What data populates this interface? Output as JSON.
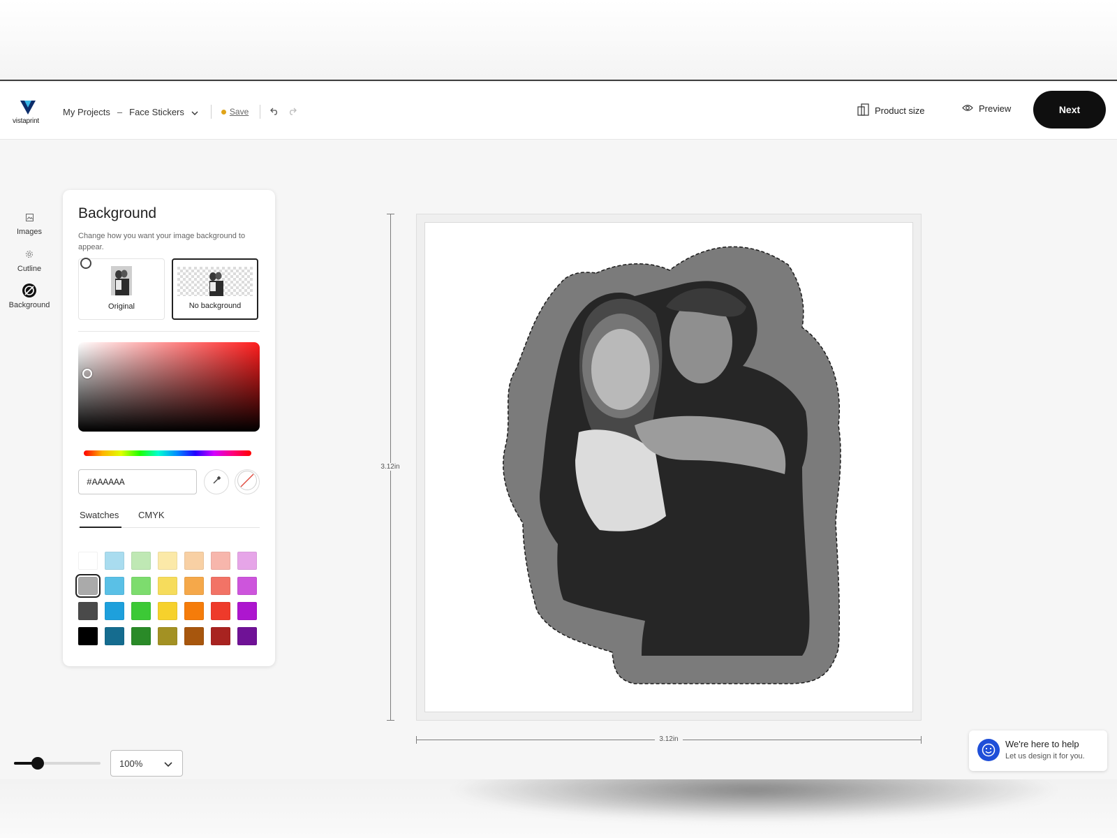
{
  "header": {
    "logo_text": "vistaprint",
    "breadcrumb_root": "My Projects",
    "breadcrumb_separator": "–",
    "project_name": "Face Stickers",
    "save_label": "Save",
    "product_size_label": "Product size",
    "preview_label": "Preview",
    "next_label": "Next"
  },
  "rail": {
    "items": [
      {
        "label": "Images",
        "icon": "image-icon"
      },
      {
        "label": "Cutline",
        "icon": "cutline-icon"
      },
      {
        "label": "Background",
        "icon": "background-icon"
      }
    ]
  },
  "panel": {
    "title": "Background",
    "description": "Change how you want your image background to appear.",
    "options": [
      {
        "label": "Original",
        "selected": false
      },
      {
        "label": "No background",
        "selected": true
      }
    ],
    "hex_value": "#AAAAAA",
    "tabs": [
      {
        "label": "Swatches",
        "active": true
      },
      {
        "label": "CMYK",
        "active": false
      }
    ],
    "swatches": [
      [
        "#ffffff",
        "#a9dcef",
        "#bfe8b4",
        "#fbe9a8",
        "#f8d0a4",
        "#f7b6ac",
        "#e6a5e8"
      ],
      [
        "#aaaaaa",
        "#5ac0e6",
        "#7ddc6e",
        "#f6dc5c",
        "#f5a84a",
        "#f27366",
        "#cd55dc"
      ],
      [
        "#4a4a4a",
        "#1ea0dc",
        "#3cc936",
        "#f6d12c",
        "#f57c0a",
        "#ee3a2a",
        "#ad16cf"
      ],
      [
        "#000000",
        "#156c8f",
        "#2a8a28",
        "#a39123",
        "#a7560d",
        "#a82320",
        "#6f1296"
      ]
    ],
    "selected_swatch": "#aaaaaa"
  },
  "canvas": {
    "height_label": "3.12in",
    "width_label": "3.12in",
    "sticker_bg_color": "#7b7b7b"
  },
  "zoom": {
    "value": "100%",
    "level": 0.25
  },
  "help": {
    "title": "We're here to help",
    "subtitle": "Let us design it for you."
  },
  "colors": {
    "accent": "#0f0f0f",
    "save_dot": "#e0a418",
    "help_icon": "#1f4fd8"
  }
}
